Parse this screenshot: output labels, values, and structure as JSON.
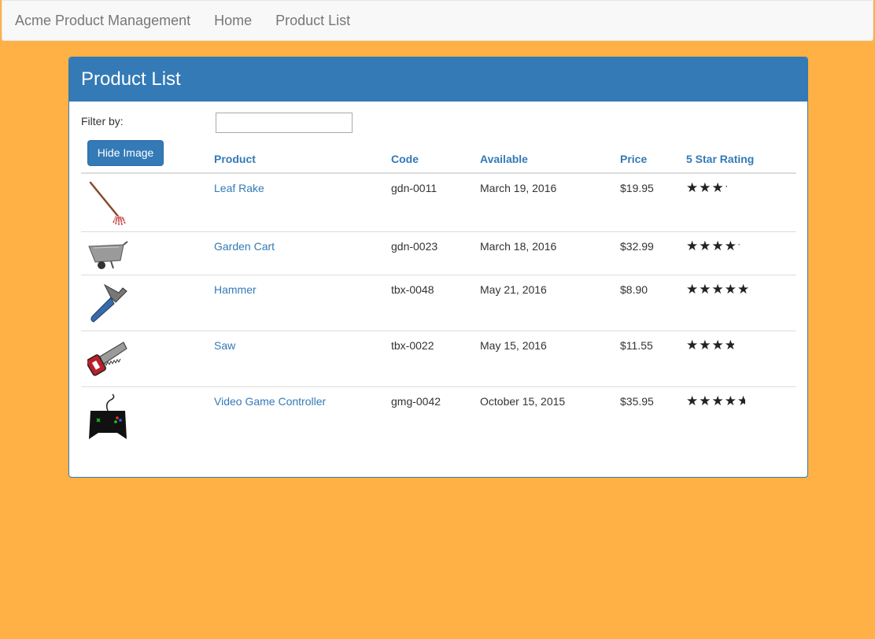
{
  "navbar": {
    "brand": "Acme Product Management",
    "links": [
      "Home",
      "Product List"
    ]
  },
  "panel": {
    "title": "Product List",
    "filter_label": "Filter by:",
    "filter_value": "",
    "toggle_image_label": "Hide Image"
  },
  "table": {
    "headers": [
      "Product",
      "Code",
      "Available",
      "Price",
      "5 Star Rating"
    ],
    "rows": [
      {
        "image": "leaf-rake-image",
        "name": "Leaf Rake",
        "code": "gdn-0011",
        "available": "March 19, 2016",
        "price": "$19.95",
        "rating": 3.2
      },
      {
        "image": "garden-cart-image",
        "name": "Garden Cart",
        "code": "gdn-0023",
        "available": "March 18, 2016",
        "price": "$32.99",
        "rating": 4.2
      },
      {
        "image": "hammer-image",
        "name": "Hammer",
        "code": "tbx-0048",
        "available": "May 21, 2016",
        "price": "$8.90",
        "rating": 4.8
      },
      {
        "image": "saw-image",
        "name": "Saw",
        "code": "tbx-0022",
        "available": "May 15, 2016",
        "price": "$11.55",
        "rating": 3.7
      },
      {
        "image": "video-game-controller-image",
        "name": "Video Game Controller",
        "code": "gmg-0042",
        "available": "October 15, 2015",
        "price": "$35.95",
        "rating": 4.6
      }
    ]
  },
  "colors": {
    "page_background": "#ffb145",
    "primary": "#337ab7",
    "link": "#337ab7"
  }
}
